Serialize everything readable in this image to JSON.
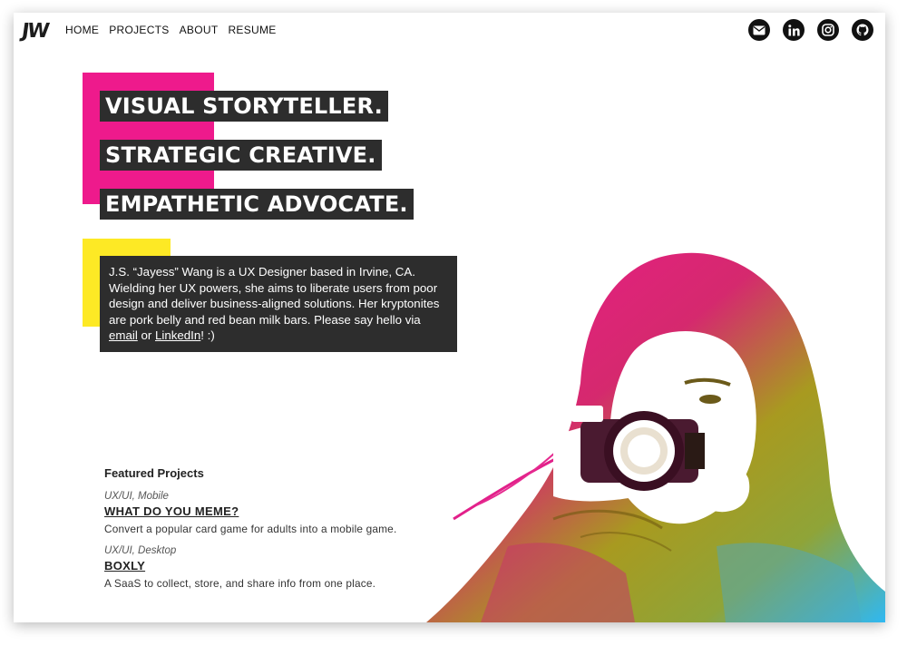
{
  "brand": {
    "logo_text": "JW"
  },
  "nav": {
    "items": [
      "HOME",
      "PROJECTS",
      "ABOUT",
      "RESUME"
    ]
  },
  "social": [
    {
      "icon": "email-icon"
    },
    {
      "icon": "linkedin-icon"
    },
    {
      "icon": "instagram-icon"
    },
    {
      "icon": "github-icon"
    }
  ],
  "hero": {
    "headlines": [
      "VISUAL STORYTELLER.",
      "STRATEGIC CREATIVE.",
      "EMPATHETIC ADVOCATE."
    ]
  },
  "bio": {
    "text_before": "J.S. “Jayess” Wang is a UX Designer based in Irvine, CA. Wielding her UX powers, she aims to liberate users from poor design and deliver business-aligned solutions. Her kryptonites are pork belly and red bean milk bars. Please say hello via ",
    "email_link": "email",
    "middle": " or ",
    "linkedin_link": "LinkedIn",
    "text_after": "! :)"
  },
  "featured": {
    "heading": "Featured Projects",
    "projects": [
      {
        "category": "UX/UI, Mobile",
        "title": "WHAT DO YOU MEME?",
        "description": "Convert a popular card game for adults into a mobile game."
      },
      {
        "category": "UX/UI, Desktop",
        "title": "BOXLY",
        "description": "A SaaS to collect, store, and share info from one place."
      }
    ]
  },
  "colors": {
    "accent_pink": "#ee1a8c",
    "accent_yellow": "#fde925",
    "dark_box": "#2d2d2d",
    "gradient_blue": "#35b9f0",
    "gradient_olive": "#9a9a22"
  }
}
